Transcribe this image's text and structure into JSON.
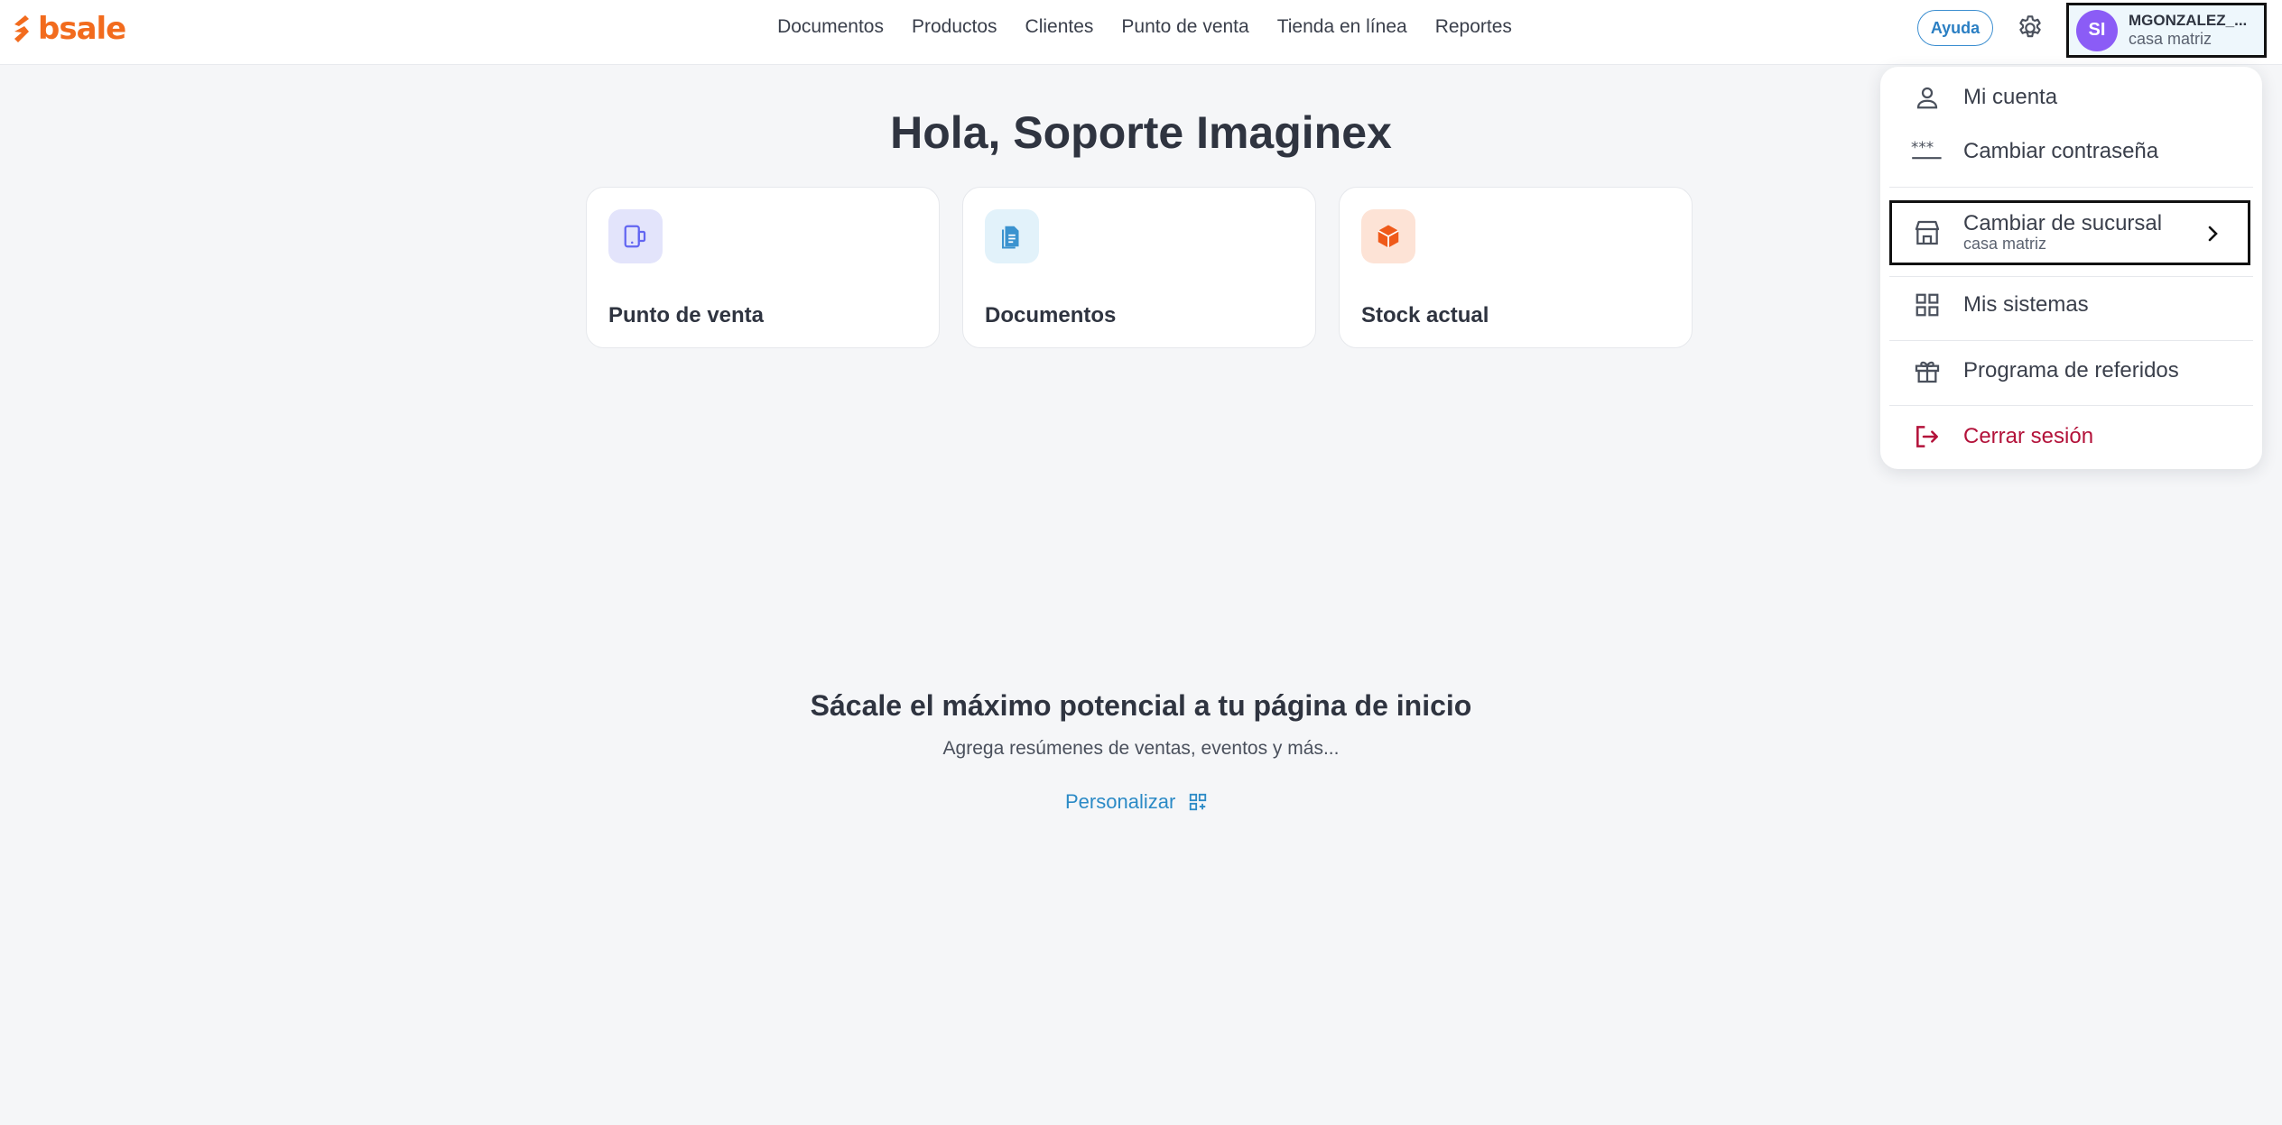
{
  "brand": {
    "logo_text": "bsale",
    "logo_color": "#f26b1d"
  },
  "nav": {
    "items": [
      {
        "label": "Documentos"
      },
      {
        "label": "Productos"
      },
      {
        "label": "Clientes"
      },
      {
        "label": "Punto de venta"
      },
      {
        "label": "Tienda en línea"
      },
      {
        "label": "Reportes"
      }
    ]
  },
  "header": {
    "help_label": "Ayuda",
    "settings_icon": "gear-icon",
    "user": {
      "initials": "SI",
      "name": "MGONZALEZ_...",
      "branch": "casa matriz",
      "avatar_color": "#8b5cf6"
    }
  },
  "main": {
    "greeting": "Hola, Soporte Imaginex",
    "cards": [
      {
        "label": "Punto de venta",
        "icon": "pos-device-icon",
        "bg": "#e3e4fb"
      },
      {
        "label": "Documentos",
        "icon": "document-icon",
        "bg": "#e2f2fa"
      },
      {
        "label": "Stock actual",
        "icon": "box-icon",
        "bg": "#fde3d6"
      }
    ],
    "promo": {
      "title": "Sácale el máximo potencial a tu página de inicio",
      "subtitle": "Agrega resúmenes de ventas, eventos y más...",
      "link_label": "Personalizar"
    }
  },
  "menu": {
    "my_account": "Mi cuenta",
    "change_password": "Cambiar contraseña",
    "change_branch": {
      "label": "Cambiar de sucursal",
      "sub": "casa matriz"
    },
    "my_systems": "Mis sistemas",
    "referrals": "Programa de referidos",
    "logout": "Cerrar sesión"
  }
}
